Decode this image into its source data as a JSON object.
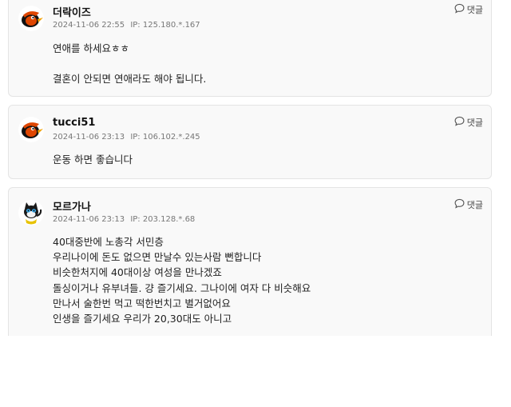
{
  "comments": [
    {
      "nickname": "더락이즈",
      "date": "2024-11-06 22:55",
      "ip_label": "IP:",
      "ip": "125.180.*.167",
      "reply_label": "댓글",
      "lines": [
        "연애를 하세요ㅎㅎ",
        "",
        "결혼이 안되면 연애라도 해야 됩니다."
      ]
    },
    {
      "nickname": "tucci51",
      "date": "2024-11-06 23:13",
      "ip_label": "IP:",
      "ip": "106.102.*.245",
      "reply_label": "댓글",
      "lines": [
        "운동 하면 좋습니다"
      ]
    },
    {
      "nickname": "모르가나",
      "date": "2024-11-06 23:13",
      "ip_label": "IP:",
      "ip": "203.128.*.68",
      "reply_label": "댓글",
      "lines": [
        "40대중반에 노총각 서민층",
        "우리나이에 돈도 없으면 만날수 있는사람 뻔합니다",
        "비슷한처지에 40대이상 여성을 만나겠죠",
        "돌싱이거나 유부녀들. 걍 즐기세요. 그나이에 여자 다 비슷해요",
        "만나서 술한번 먹고 떡한번치고 별거없어요",
        "인생을 즐기세요 우리가 20,30대도 아니고"
      ]
    }
  ],
  "colors": {
    "card_bg": "#f9f9f9",
    "card_border": "#e4e4e4",
    "orioles_orange": "#df4601",
    "orioles_black": "#000000"
  }
}
